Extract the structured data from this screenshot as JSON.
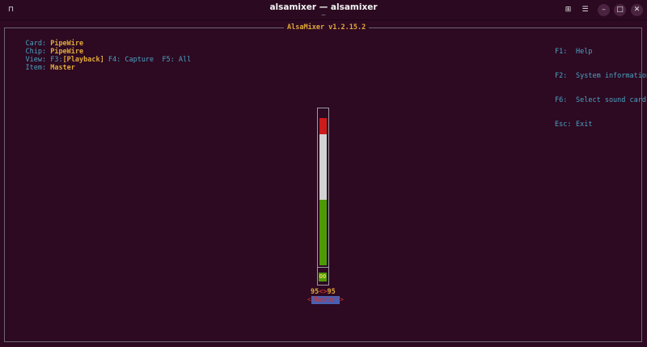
{
  "window": {
    "title": "alsamixer — alsamixer",
    "subtitle": "~"
  },
  "mixer": {
    "title": "AlsaMixer v1.2.15.2",
    "card_label": "Card:",
    "card_value": "PipeWire",
    "chip_label": "Chip:",
    "chip_value": "PipeWire",
    "view_label": "View:",
    "view_f3": "F3:",
    "view_playback": "[Playback]",
    "view_f4": "F4: Capture",
    "view_f5": "F5: All",
    "item_label": "Item:",
    "item_value": "Master"
  },
  "keys": [
    {
      "key": "F1:",
      "desc": "Help"
    },
    {
      "key": "F2:",
      "desc": "System information"
    },
    {
      "key": "F6:",
      "desc": "Select sound card"
    },
    {
      "key": "Esc:",
      "desc": "Exit"
    }
  ],
  "control": {
    "name": "Master",
    "volume_left": "95",
    "volume_sep": "<>",
    "volume_right": "95",
    "mute_text": "OO",
    "level_percent": 95,
    "colors": {
      "green": "#4e9a06",
      "white": "#d3d3d3",
      "red": "#cc1b1b"
    }
  },
  "colors": {
    "background": "#2d0922",
    "accent": "#e0a93a",
    "label": "#4aa3c0"
  }
}
